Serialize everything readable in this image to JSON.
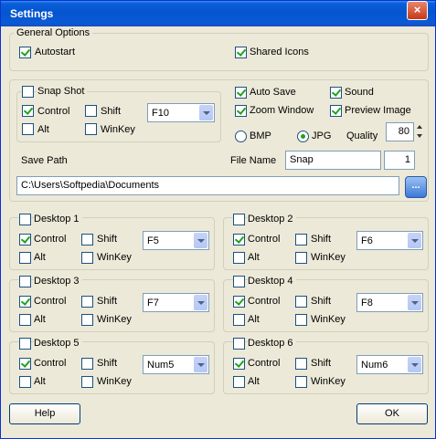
{
  "window": {
    "title": "Settings",
    "close_glyph": "×"
  },
  "general": {
    "legend": "General Options",
    "autostart": "Autostart",
    "shared_icons": "Shared Icons"
  },
  "snapshot": {
    "label": "Snap Shot",
    "control": "Control",
    "shift": "Shift",
    "alt": "Alt",
    "winkey": "WinKey",
    "key": "F10",
    "auto_save": "Auto Save",
    "sound": "Sound",
    "zoom_window": "Zoom Window",
    "preview_image": "Preview Image",
    "bmp": "BMP",
    "jpg": "JPG",
    "quality_label": "Quality",
    "quality_value": "80",
    "save_path_label": "Save Path",
    "file_name_label": "File Name",
    "file_name_value": "Snap",
    "file_counter": "1",
    "path_value": "C:\\Users\\Softpedia\\Documents",
    "browse_label": "..."
  },
  "desktops": [
    {
      "label": "Desktop 1",
      "key": "F5"
    },
    {
      "label": "Desktop 2",
      "key": "F6"
    },
    {
      "label": "Desktop 3",
      "key": "F7"
    },
    {
      "label": "Desktop 4",
      "key": "F8"
    },
    {
      "label": "Desktop 5",
      "key": "Num5"
    },
    {
      "label": "Desktop 6",
      "key": "Num6"
    }
  ],
  "modifiers": {
    "control": "Control",
    "shift": "Shift",
    "alt": "Alt",
    "winkey": "WinKey"
  },
  "footer": {
    "help": "Help",
    "ok": "OK"
  }
}
